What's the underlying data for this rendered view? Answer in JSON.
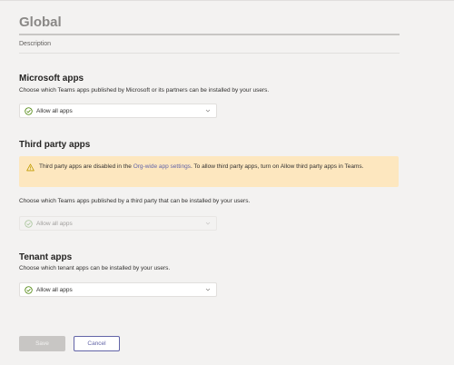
{
  "policy": {
    "name": "Global",
    "description_placeholder": "Description"
  },
  "microsoft_apps": {
    "title": "Microsoft apps",
    "subtitle": "Choose which Teams apps published by Microsoft or its partners can be installed by your users.",
    "dropdown_value": "Allow all apps"
  },
  "third_party_apps": {
    "title": "Third party apps",
    "banner_text_before": "Third party apps are disabled in the ",
    "banner_link": "Org-wide app settings",
    "banner_text_after": ". To allow third party apps, turn on Allow third party apps in Teams.",
    "subtitle": "Choose which Teams apps published by a third party that can be installed by your users.",
    "dropdown_value": "Allow all apps"
  },
  "tenant_apps": {
    "title": "Tenant apps",
    "subtitle": "Choose which tenant apps can be installed by your users.",
    "dropdown_value": "Allow all apps"
  },
  "buttons": {
    "save": "Save",
    "cancel": "Cancel"
  },
  "colors": {
    "accent": "#6264a7",
    "warning_bg": "#fde7bf",
    "warning_icon": "#c19c00",
    "check_icon": "#498205"
  },
  "icons": {
    "dropdown_status": "check-circle-icon",
    "dropdown_toggle": "chevron-down-icon",
    "banner": "warning-icon"
  }
}
